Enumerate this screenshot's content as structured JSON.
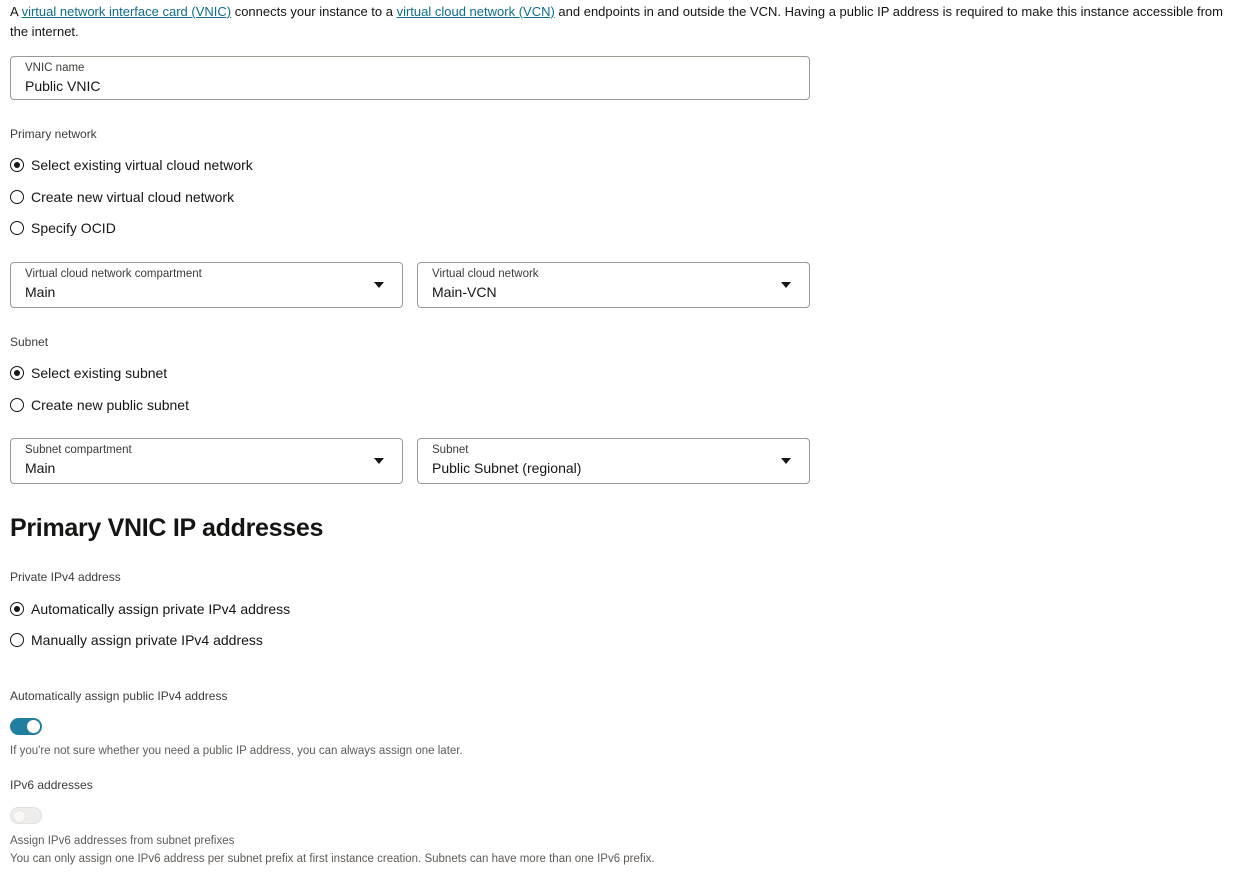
{
  "intro": {
    "prefix": "A ",
    "vnic_link": "virtual network interface card (VNIC)",
    "middle": " connects your instance to a ",
    "vcn_link": "virtual cloud network (VCN)",
    "suffix": " and endpoints in and outside the VCN. Having a public IP address is required to make this instance accessible from the internet."
  },
  "vnic_name": {
    "label": "VNIC name",
    "value": "Public VNIC"
  },
  "primary_network": {
    "label": "Primary network",
    "options": [
      {
        "label": "Select existing virtual cloud network",
        "checked": true
      },
      {
        "label": "Create new virtual cloud network",
        "checked": false
      },
      {
        "label": "Specify OCID",
        "checked": false
      }
    ],
    "compartment": {
      "label": "Virtual cloud network compartment",
      "value": "Main"
    },
    "vcn": {
      "label": "Virtual cloud network",
      "value": "Main-VCN"
    }
  },
  "subnet": {
    "label": "Subnet",
    "options": [
      {
        "label": "Select existing subnet",
        "checked": true
      },
      {
        "label": "Create new public subnet",
        "checked": false
      }
    ],
    "compartment": {
      "label": "Subnet compartment",
      "value": "Main"
    },
    "subnet_select": {
      "label": "Subnet",
      "value": "Public Subnet (regional)"
    }
  },
  "ip_section": {
    "heading": "Primary VNIC IP addresses",
    "private_label": "Private IPv4 address",
    "private_options": [
      {
        "label": "Automatically assign private IPv4 address",
        "checked": true
      },
      {
        "label": "Manually assign private IPv4 address",
        "checked": false
      }
    ],
    "public_label": "Automatically assign public IPv4 address",
    "public_toggle_on": true,
    "public_help": "If you're not sure whether you need a public IP address, you can always assign one later.",
    "ipv6_label": "IPv6 addresses",
    "ipv6_toggle_on": false,
    "ipv6_help_1": "Assign IPv6 addresses from subnet prefixes",
    "ipv6_help_2": "You can only assign one IPv6 address per subnet prefix at first instance creation. Subnets can have more than one IPv6 prefix."
  },
  "colors": {
    "accent": "#227e9e",
    "link": "#0e6d8a",
    "text": "#161513",
    "border": "#9e9892"
  }
}
